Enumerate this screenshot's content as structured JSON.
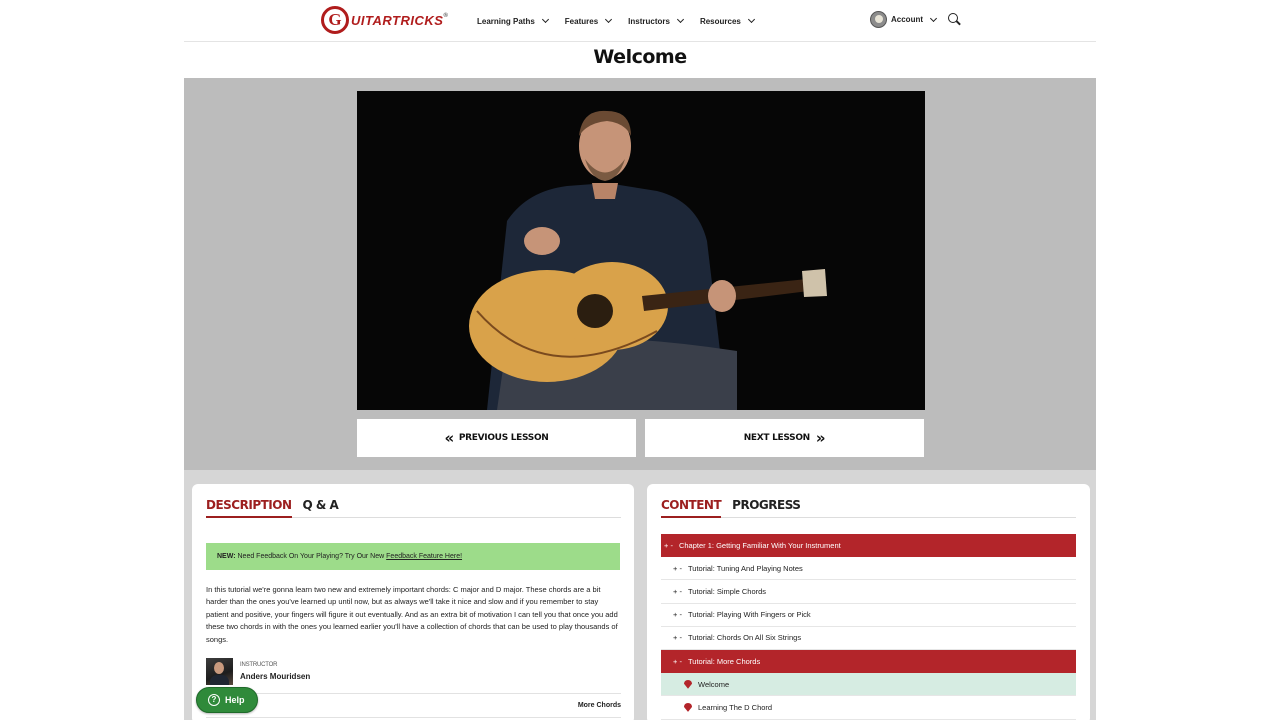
{
  "header": {
    "logo_letter": "G",
    "logo_text": "UITARTRICKS",
    "logo_tm": "®",
    "nav": [
      "Learning Paths",
      "Features",
      "Instructors",
      "Resources"
    ],
    "account_label": "Account"
  },
  "page_title": "Welcome",
  "player": {
    "prev_label": "PREVIOUS LESSON",
    "next_label": "NEXT LESSON"
  },
  "left_panel": {
    "tabs": [
      "DESCRIPTION",
      "Q & A"
    ],
    "notice": {
      "prefix": "NEW:",
      "text": "Need Feedback On Your Playing? Try Our New",
      "link": "Feedback Feature Here!"
    },
    "description": "In this tutorial we're gonna learn two new and extremely important chords: C major and D major. These chords are a bit harder than the ones you've learned up until now, but as always we'll take it nice and slow and if you remember to stay patient and positive, your fingers will figure it out eventually. And as an extra bit of motivation I can tell you that once you add these two chords in with the ones you learned earlier you'll have a collection of chords that can be used to play thousands of songs.",
    "instructor_role": "Instructor",
    "instructor_name": "Anders Mouridsen",
    "more_link": "More Chords"
  },
  "right_panel": {
    "tabs": [
      "CONTENT",
      "PROGRESS"
    ],
    "chapter": "Chapter 1: Getting Familiar With Your Instrument",
    "pm": "+ -",
    "tutorials": [
      "Tutorial: Tuning And Playing Notes",
      "Tutorial: Simple Chords",
      "Tutorial: Playing With Fingers or Pick",
      "Tutorial: Chords On All Six Strings",
      "Tutorial: More Chords"
    ],
    "lessons": [
      "Welcome",
      "Learning The D Chord"
    ]
  },
  "help_label": "Help",
  "colors": {
    "brand_red": "#b3252a",
    "notice_green": "#9ddc8a",
    "current_lesson": "#d6ece2",
    "help_green": "#2f8a3a"
  }
}
